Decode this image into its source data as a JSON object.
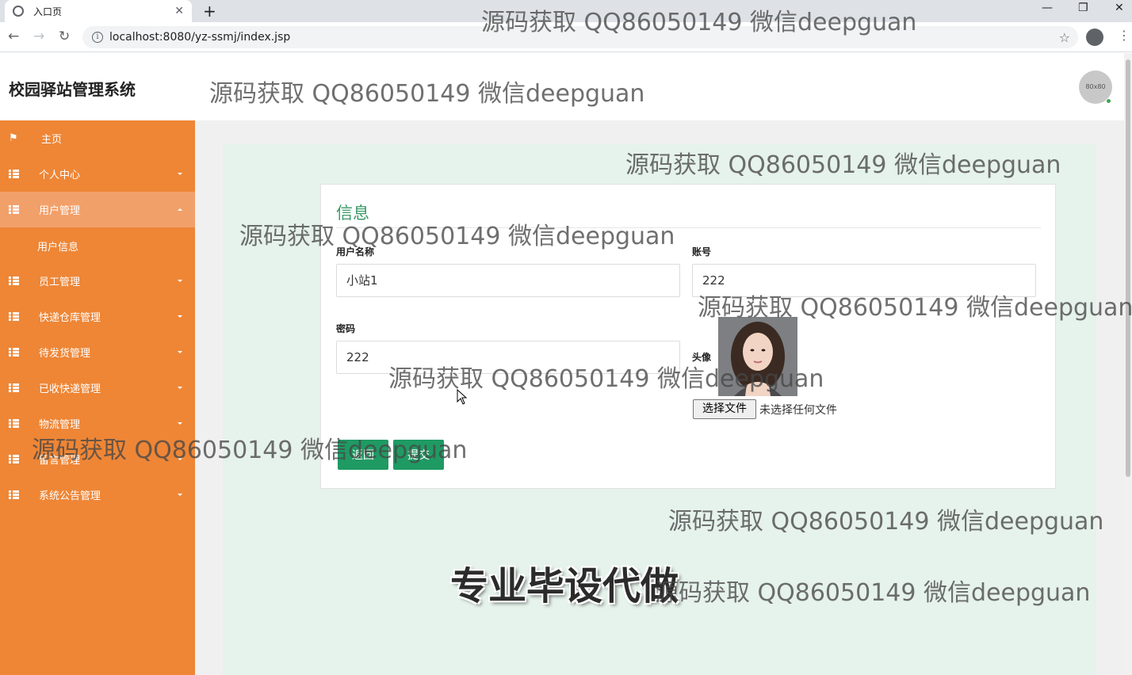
{
  "browser": {
    "tab_title": "入口页",
    "new_tab": "+",
    "url": "localhost:8080/yz-ssmj/index.jsp",
    "window_controls": [
      "—",
      "❐",
      "✕"
    ]
  },
  "app": {
    "brand": "校园驿站管理系统",
    "avatar_placeholder": "80x80"
  },
  "sidebar": {
    "items": [
      {
        "label": "主页",
        "icon": "flag-icon"
      },
      {
        "label": "个人中心",
        "icon": "grid-icon"
      },
      {
        "label": "用户管理",
        "icon": "grid-icon",
        "expanded": true
      },
      {
        "label": "用户信息",
        "icon": "",
        "sub": true
      },
      {
        "label": "员工管理",
        "icon": "grid-icon"
      },
      {
        "label": "快递仓库管理",
        "icon": "grid-icon"
      },
      {
        "label": "待发货管理",
        "icon": "grid-icon"
      },
      {
        "label": "已收快递管理",
        "icon": "grid-icon"
      },
      {
        "label": "物流管理",
        "icon": "grid-icon"
      },
      {
        "label": "留言管理",
        "icon": "grid-icon"
      },
      {
        "label": "系统公告管理",
        "icon": "grid-icon"
      }
    ],
    "colors": {
      "bg": "#ee8636",
      "active": "#f2a06a"
    }
  },
  "form": {
    "title": "信息",
    "fields": {
      "username": {
        "label": "用户名称",
        "value": "小站1"
      },
      "account": {
        "label": "账号",
        "value": "222"
      },
      "password": {
        "label": "密码",
        "value": "222"
      },
      "avatar": {
        "label": "头像"
      }
    },
    "file_button": "选择文件",
    "file_status": "未选择任何文件",
    "back_button": "返回",
    "submit_button": "提交",
    "accent": "#1f9a63"
  },
  "watermarks": {
    "text": "源码获取 QQ86050149 微信deepguan",
    "big_text": "专业毕设代做"
  }
}
